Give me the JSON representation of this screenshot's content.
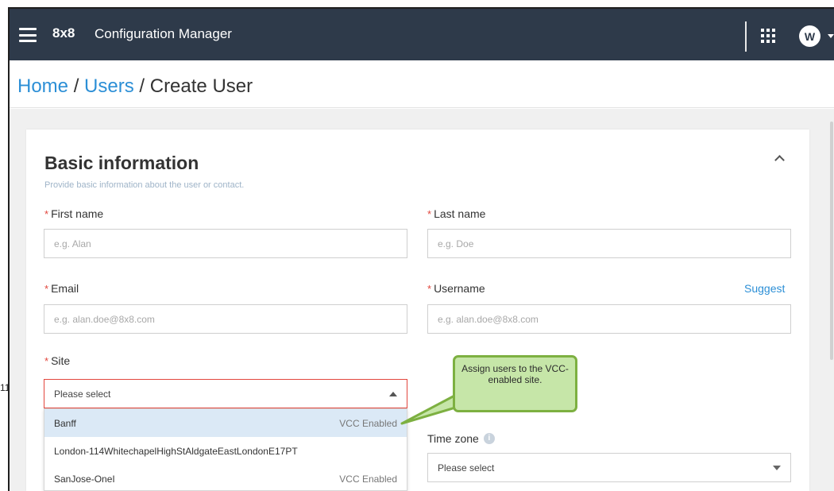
{
  "header": {
    "brand": "8x8",
    "app_title": "Configuration Manager",
    "avatar_initial": "W"
  },
  "breadcrumb": {
    "home": "Home",
    "sep1": " / ",
    "users": "Users",
    "sep2": " / ",
    "current": "Create User"
  },
  "section": {
    "title": "Basic information",
    "subtitle": "Provide basic information about the user or contact."
  },
  "form": {
    "required_mark": "*",
    "first_name": {
      "label": "First name",
      "placeholder": "e.g. Alan"
    },
    "last_name": {
      "label": "Last name",
      "placeholder": "e.g. Doe"
    },
    "email": {
      "label": "Email",
      "placeholder": "e.g. alan.doe@8x8.com"
    },
    "username": {
      "label": "Username",
      "placeholder": "e.g. alan.doe@8x8.com",
      "suggest_label": "Suggest"
    },
    "site": {
      "label": "Site",
      "value": "Please select",
      "options": [
        {
          "name": "Banff",
          "tag": "VCC Enabled"
        },
        {
          "name": "London-114WhitechapelHighStAldgateEastLondonE17PT",
          "tag": ""
        },
        {
          "name": "SanJose-OneI",
          "tag": "VCC Enabled"
        }
      ]
    },
    "time_zone": {
      "label": "Time zone",
      "value": "Please select",
      "info_glyph": "i"
    }
  },
  "callout": {
    "text": "Assign users to the VCC-enabled site."
  },
  "side_number": "11",
  "colors": {
    "topbar": "#2e3a4a",
    "link": "#2c8fd6",
    "required": "#e2463d",
    "callout_fill": "#c6e6a8",
    "callout_border": "#7db041"
  }
}
